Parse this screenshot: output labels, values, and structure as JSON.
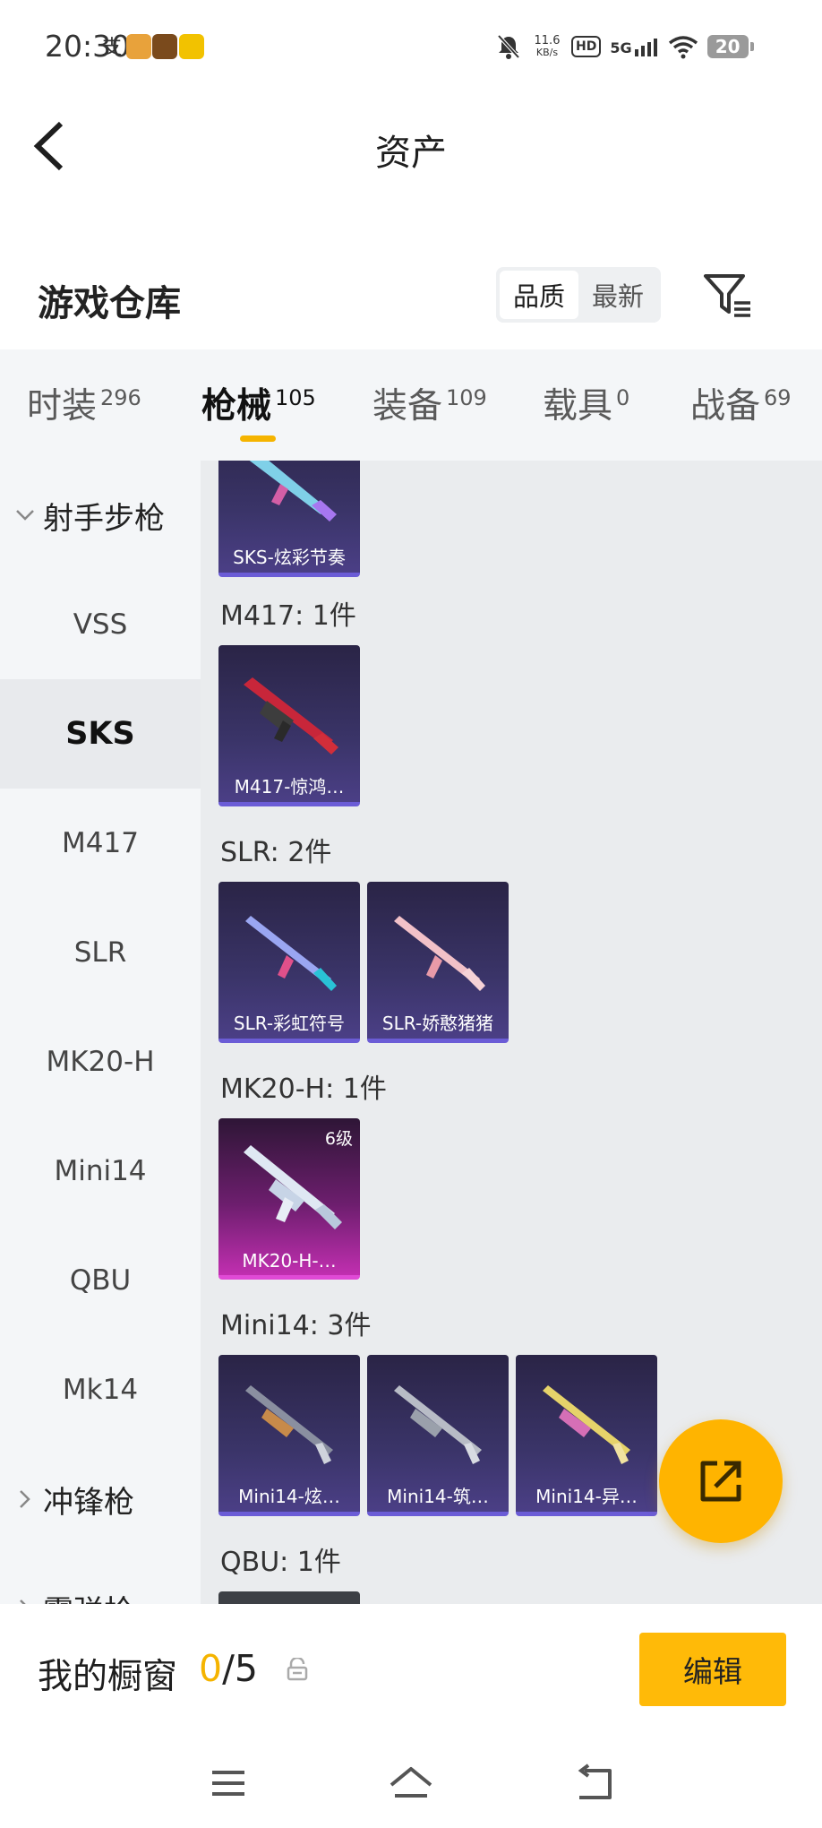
{
  "status_bar": {
    "time": "20:30",
    "net_speed_value": "11.6",
    "net_speed_unit": "KB/s",
    "hd": "HD",
    "network": "5G",
    "battery": "20"
  },
  "header": {
    "title": "资产"
  },
  "warehouse": {
    "title": "游戏仓库",
    "sort_options": [
      "品质",
      "最新"
    ],
    "sort_selected": "品质"
  },
  "tabs": [
    {
      "label": "时装",
      "count": "296"
    },
    {
      "label": "枪械",
      "count": "105",
      "active": true
    },
    {
      "label": "装备",
      "count": "109"
    },
    {
      "label": "载具",
      "count": "0"
    },
    {
      "label": "战备",
      "count": "69"
    }
  ],
  "sidebar": {
    "group_1": "射手步枪",
    "items": [
      "VSS",
      "SKS",
      "M417",
      "SLR",
      "MK20-H",
      "Mini14",
      "QBU",
      "Mk14"
    ],
    "active": "SKS",
    "group_2": "冲锋枪",
    "group_3_partial": "霰弹枪"
  },
  "sections": [
    {
      "label": "",
      "cards": [
        {
          "name": "SKS-炫彩节奏",
          "quality": "epic"
        }
      ]
    },
    {
      "label": "M417: 1件",
      "cards": [
        {
          "name": "M417-惊鸿…",
          "quality": "epic"
        }
      ]
    },
    {
      "label": "SLR: 2件",
      "cards": [
        {
          "name": "SLR-彩虹符号",
          "quality": "epic"
        },
        {
          "name": "SLR-娇憨猪猪",
          "quality": "epic"
        }
      ]
    },
    {
      "label": "MK20-H: 1件",
      "cards": [
        {
          "name": "MK20-H-…",
          "quality": "legendary",
          "level": "6级"
        }
      ]
    },
    {
      "label": "Mini14: 3件",
      "cards": [
        {
          "name": "Mini14-炫…",
          "quality": "epic"
        },
        {
          "name": "Mini14-筑…",
          "quality": "epic"
        },
        {
          "name": "Mini14-异…",
          "quality": "epic"
        }
      ]
    },
    {
      "label": "QBU: 1件",
      "cards": []
    }
  ],
  "showcase": {
    "label": "我的橱窗",
    "current": "0",
    "separator_total": "/5",
    "edit_label": "编辑"
  },
  "colors": {
    "accent": "#ffb400",
    "epic_card": "#3a3468",
    "legendary_card": "#c12fb0",
    "content_bg": "#eaecee",
    "sidebar_bg": "#f4f6f8"
  }
}
